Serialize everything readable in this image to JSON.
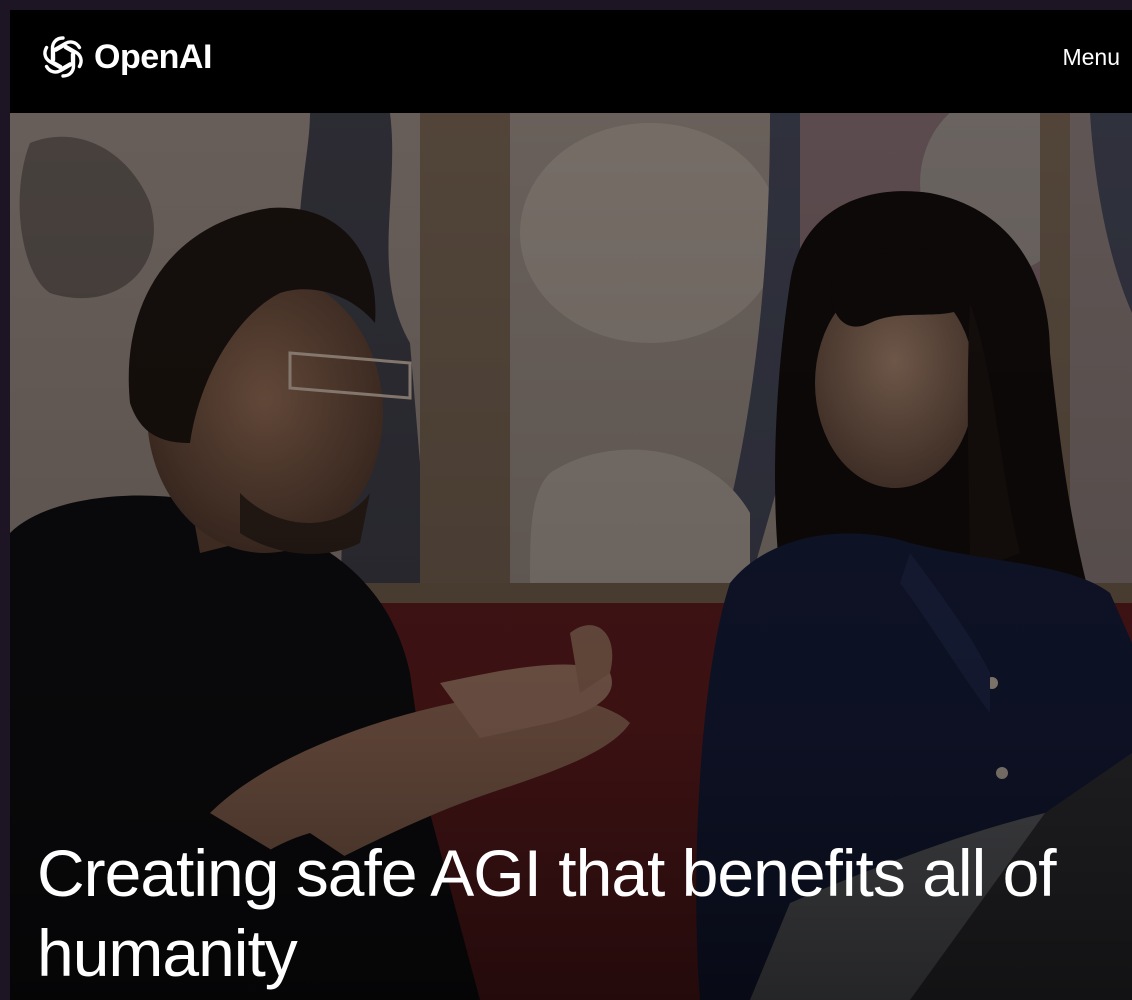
{
  "header": {
    "brand": "OpenAI",
    "menu_label": "Menu"
  },
  "hero": {
    "headline": "Creating safe AGI that benefits all of humanity"
  },
  "icons": {
    "logo": "openai-logo-icon"
  },
  "colors": {
    "page_background": "#1d1424",
    "nav_background": "#000000",
    "text": "#ffffff"
  }
}
